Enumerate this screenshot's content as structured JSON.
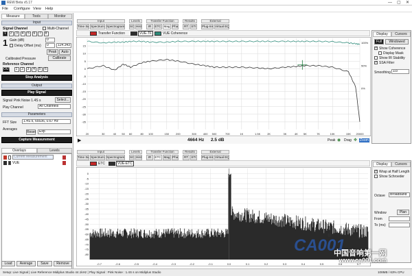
{
  "window": {
    "title": "REW Beta v5.17",
    "min": "—",
    "max": "▢",
    "close": "✕"
  },
  "menu": [
    "File",
    "Configure",
    "View",
    "Help"
  ],
  "left": {
    "tabs": [
      "Measure",
      "Tools",
      "Monitor"
    ],
    "input_header": "Input",
    "signal_channel": "Signal Channel",
    "multi_channel": "Multi-Channel",
    "channels": [
      "1",
      "2",
      "3",
      "4",
      "5",
      "6",
      "7",
      "8"
    ],
    "gain_label": "Gain (dB)",
    "gain_value": "0",
    "delay_label": "Delay Offset (ms)",
    "delay_value": "0",
    "unknown_value": "124.343",
    "peak": "Peak",
    "auto": "Auto",
    "calibrated_pressure": "Calibrated Pressure",
    "calibrate": "Calibrate",
    "ref_channel": "Reference Channel",
    "ref_channels": [
      "OUT",
      "1",
      "2",
      "3",
      "4",
      "5",
      "6"
    ],
    "stop_analysis": "Stop Analysis",
    "output_header": "Output",
    "play_signal": "Play Signal",
    "signal_label": "Signal",
    "signal_value": "Pink Noise  1.4S s",
    "select": "Select...",
    "play_channel_label": "Play Channel",
    "play_channel_value": "All Channels",
    "params_header": "Parameters",
    "fft_label": "FFT Size",
    "fft_value": "1.4S s, 65536, 0.67 Hz",
    "averages_label": "Averages",
    "averages_value": "Exp",
    "reset": "Reset",
    "capture": "Capture Measurement",
    "overlay_tabs": [
      "Overlays",
      "Levels"
    ],
    "overlays": [
      {
        "name": "Current Measurement",
        "color": "#c0392b"
      },
      {
        "name": "VUE",
        "color": "#2c2c2c"
      }
    ],
    "bottom_buttons": [
      "Load",
      "Average",
      "Save",
      "Remove"
    ]
  },
  "top": {
    "groups": [
      "Input",
      "Levels",
      "Transfer Function",
      "Results",
      "External"
    ],
    "tabs": [
      "Time Signal",
      "Spectrum",
      "Spectrogram",
      "SC",
      "Histo",
      "IR",
      "ETC",
      "Mag",
      "Pha",
      "RT",
      "STI",
      "Plug-Ins",
      "Virtual EQ"
    ],
    "selected_tab": "Mag",
    "legend": [
      {
        "name": "Transfer Function",
        "color": "#c62828"
      },
      {
        "name": "VUE-TF",
        "color": "#2f2f2f"
      },
      {
        "name": "VUE Coherence",
        "color": "#2e8b7a"
      }
    ],
    "readout_freq": "4664 Hz",
    "readout_db": "2.5 dB",
    "peak": "Peak",
    "drag": "Drag",
    "zoom": "Zoom",
    "right_tabs": [
      "Display",
      "Cursors"
    ],
    "full": "Full",
    "windowed": "Windowed",
    "show_coherence": "Show Coherence",
    "display_mask": "Display Mask",
    "show_ir_stability": "Show IR Stability",
    "ssa_filter": "SSA Filter",
    "smoothing_label": "Smoothing",
    "smoothing_value": "1/3",
    "right_axis": [
      "100%",
      "50%",
      "0%"
    ]
  },
  "bottom": {
    "tabs": [
      "Time Signal",
      "Spectrum",
      "Spectrogram",
      "SC",
      "Histo",
      "IR",
      "ETC",
      "Mag",
      "Pha",
      "RT",
      "STI",
      "Plug-Ins",
      "Virtual EQ"
    ],
    "selected_tab": "ETC",
    "groups": [
      "Input",
      "Levels",
      "Transfer Function",
      "Results",
      "External"
    ],
    "legend": [
      {
        "name": "ETC",
        "color": "#c62828"
      },
      {
        "name": "VUE-ETC",
        "color": "#2f2f2f"
      }
    ],
    "right_tabs": [
      "Display",
      "Cursors"
    ],
    "wrap": "Wrap at Half Length",
    "show_schroeder": "Show Schroeder",
    "octave_label": "Octave",
    "octave_value": "Broadband",
    "window_label": "Window",
    "window_btn": "Plan",
    "from_label": "From",
    "to_label": "To (ms)"
  },
  "status": {
    "left": "Setup: Live Signal | Live Reference Midiplus Studio 44.1kHz | Play Signal : Pink Noise : 1.4S s on Midiplus Studio",
    "right": "108MB / 63% CPU"
  },
  "watermark": {
    "logo": "CA001",
    "tagline": "中国音响第一网",
    "url": "www.ca001.com",
    "reg": "®"
  },
  "chart_data": [
    {
      "type": "line",
      "title": "",
      "x": [
        20,
        30,
        40,
        50,
        60,
        80,
        100,
        150,
        200,
        300,
        400,
        500,
        700,
        1000,
        1500,
        2000,
        3000,
        4000,
        5000,
        7000,
        10000,
        15000,
        18000,
        20000
      ],
      "xlabel": "",
      "ylabel": "",
      "xscale": "log",
      "xlim": [
        20,
        20000
      ],
      "ylim": [
        -40,
        20
      ],
      "x_ticks": [
        "20",
        "30",
        "40",
        "50",
        "60",
        "80",
        "100",
        "150",
        "200",
        "300",
        "400",
        "500",
        "700",
        "1K",
        "1.5K",
        "2K",
        "3K",
        "4K",
        "5K",
        "7K",
        "10K",
        "15K",
        "20000"
      ],
      "y_ticks": [
        "15",
        "10",
        "5",
        "0",
        "-5",
        "-10",
        "-15",
        "-20",
        "-25",
        "-30",
        "-35"
      ],
      "series": [
        {
          "name": "VUE-TF",
          "values": [
            0,
            2,
            -1,
            3,
            1,
            4,
            5,
            6,
            5,
            3,
            2,
            1,
            1,
            1,
            0.5,
            0,
            1,
            1.5,
            2,
            2,
            1,
            -2,
            -12,
            -35
          ]
        },
        {
          "name": "VUE Coherence",
          "values": [
            18,
            17,
            17.5,
            17.5,
            18,
            18,
            17.5,
            17.5,
            18,
            18,
            18,
            18,
            18,
            18,
            18,
            18,
            18,
            18,
            18,
            18,
            17.8,
            17,
            16.5,
            16
          ]
        }
      ],
      "cursor": {
        "x": 4664,
        "y": 2.5
      }
    },
    {
      "type": "line",
      "title": "",
      "xlabel": "",
      "ylabel": "",
      "xlim": [
        -0.75,
        0.75
      ],
      "ylim": [
        -85,
        5
      ],
      "x_ticks": [
        "-0.7",
        "-0.6",
        "-0.5",
        "-0.4",
        "-0.3",
        "-0.2",
        "-0.1",
        "0.0",
        "0.1",
        "0.2",
        "0.3",
        "0.4",
        "0.5",
        "0.6",
        "0.7"
      ],
      "y_ticks": [
        "0",
        "-5",
        "-10",
        "-15",
        "-20",
        "-25",
        "-30",
        "-35",
        "-40",
        "-45",
        "-50",
        "-55",
        "-60",
        "-65",
        "-70",
        "-75",
        "-80"
      ],
      "series": [
        {
          "name": "VUE-ETC",
          "noise_floor_pre": -62,
          "peak_db": 0,
          "early_level_db": -42,
          "late_level_db": -60
        }
      ]
    }
  ]
}
